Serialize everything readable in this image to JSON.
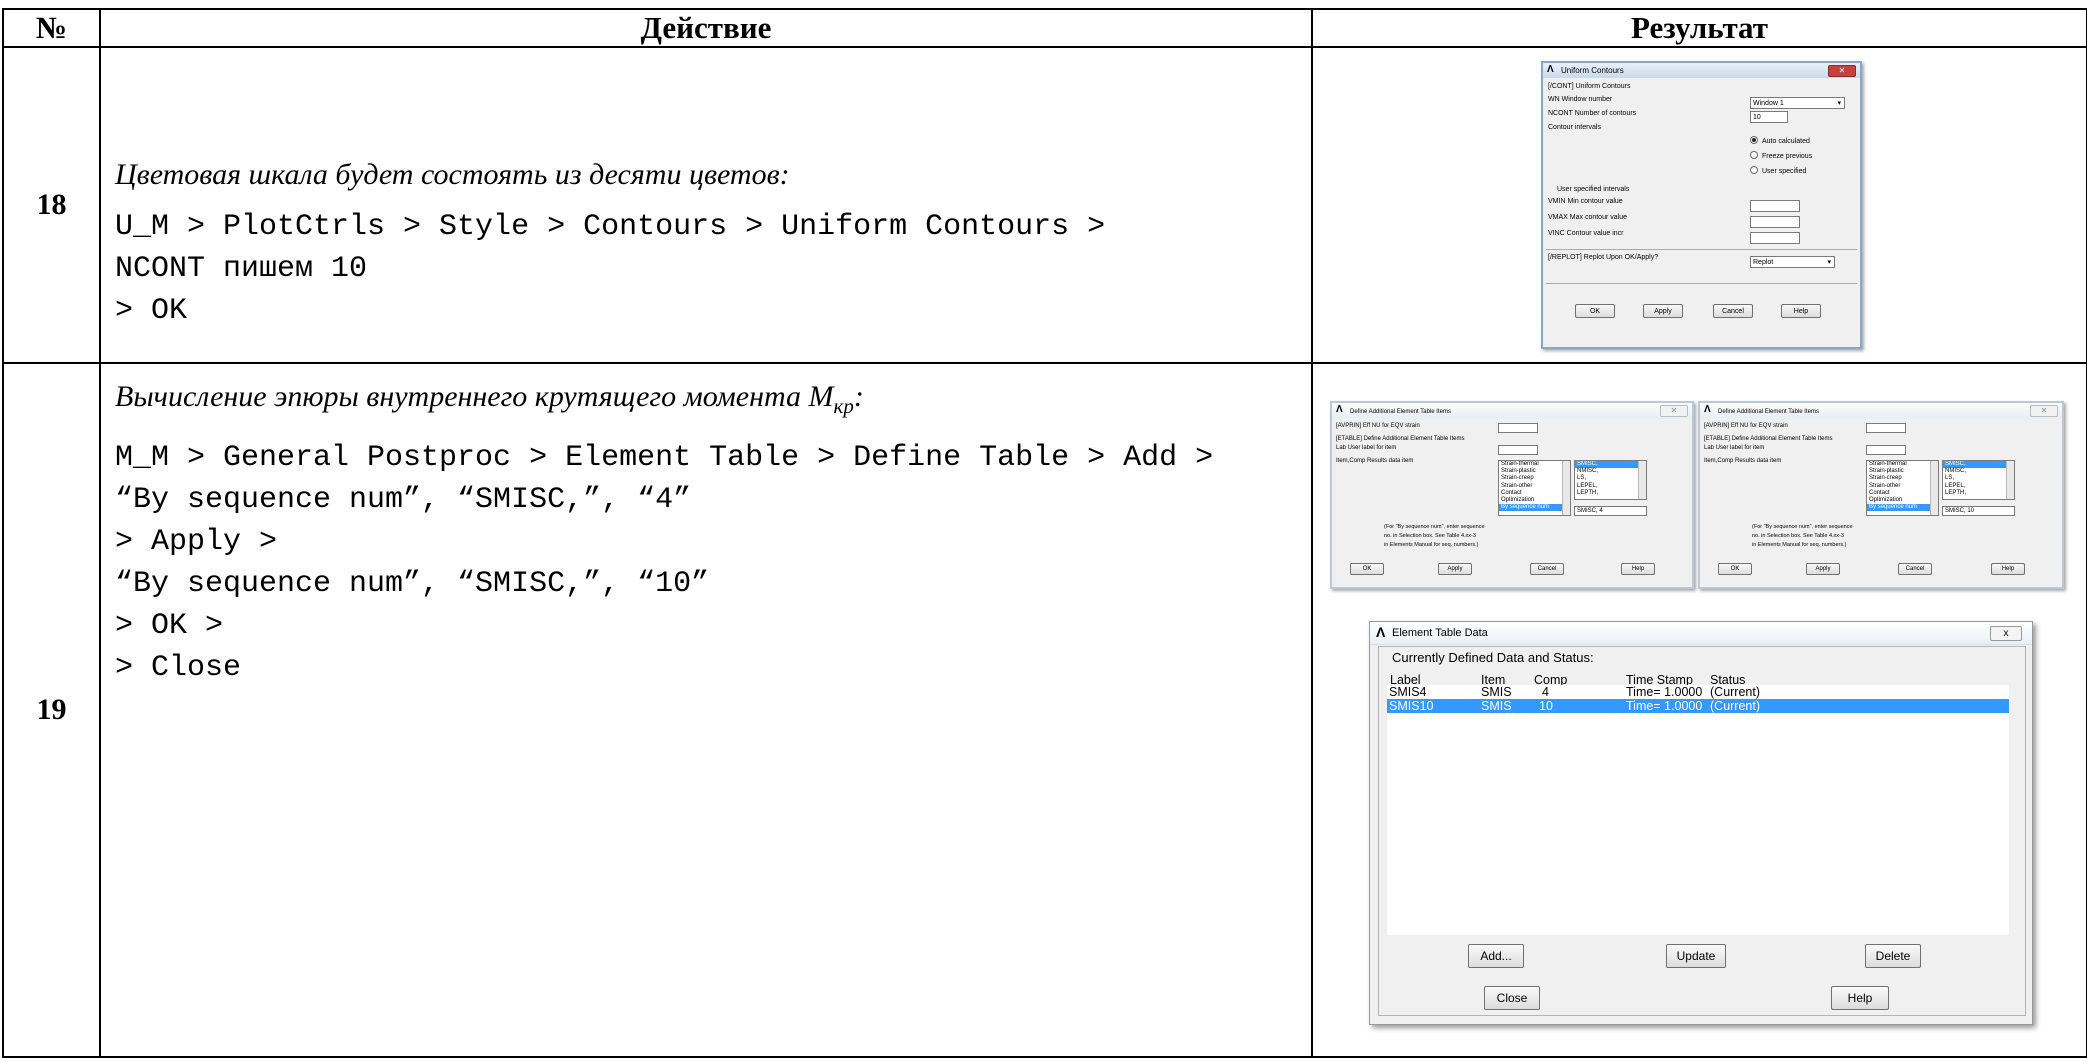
{
  "table": {
    "headers": [
      "№",
      "Действие",
      "Результат"
    ],
    "rows": [
      {
        "num": "18",
        "desc": "Цветовая шкала будет состоять из десяти цветов:",
        "lines": [
          "U_M > PlotCtrls > Style > Contours > Uniform Contours >",
          "NCONT пишем 10",
          "> OK"
        ]
      },
      {
        "num": "19",
        "desc_main": "Вычисление эпюры внутреннего крутящего момента M",
        "desc_sub": "кр",
        "desc_end": ":",
        "lines": [
          "M_M > General Postproc > Element Table > Define Table > Add >",
          "“By sequence num”, “SMISC,”, “4”",
          "> Apply >",
          "“By sequence num”, “SMISC,”, “10”",
          "> OK >",
          "> Close"
        ]
      }
    ]
  },
  "uniform_contours": {
    "title": "Uniform Contours",
    "cont_label": "[/CONT] Uniform Contours",
    "wn_label": "WN   Window number",
    "wn_value": "Window 1",
    "ncont_label": "NCONT  Number of contours",
    "ncont_value": "10",
    "intervals_label": "Contour intervals",
    "options": [
      "Auto calculated",
      "Freeze previous",
      "User specified"
    ],
    "user_label": "User specified intervals",
    "vmin_label": "VMIN   Min contour value",
    "vmax_label": "VMAX   Max contour value",
    "vinc_label": "VINC   Contour value incr",
    "replot_label": "[/REPLOT]  Replot Upon OK/Apply?",
    "replot_value": "Replot",
    "buttons": [
      "OK",
      "Apply",
      "Cancel",
      "Help"
    ]
  },
  "define_items": [
    {
      "title": "Define Additional Element Table Items",
      "avprin": "[AVPRIN]  Eff NU for EQV strain",
      "etable": "[ETABLE]  Define Additional Element Table Items",
      "lab": "Lab    User label for item",
      "itemcomp": "Item,Comp  Results data item",
      "list_left": [
        "Strain-thermal",
        "Strain-plastic",
        "Strain-creep",
        "Strain-other",
        "Contact",
        "Optimization",
        "By sequence num"
      ],
      "list_right": [
        "SMISC,",
        "NMISC,",
        "LS,",
        "LEPEL,",
        "LEPTH,"
      ],
      "value": "SMISC, 4",
      "note1": "(For \"By sequence num\", enter sequence",
      "note2": "no. in Selection box.  See Table 4.xx-3",
      "note3": "in Elements Manual for seq. numbers.)",
      "buttons": [
        "OK",
        "Apply",
        "Cancel",
        "Help"
      ]
    },
    {
      "title": "Define Additional Element Table Items",
      "avprin": "[AVPRIN]  Eff NU for EQV strain",
      "etable": "[ETABLE]  Define Additional Element Table Items",
      "lab": "Lab    User label for item",
      "itemcomp": "Item,Comp  Results data item",
      "list_left": [
        "Strain-thermal",
        "Strain-plastic",
        "Strain-creep",
        "Strain-other",
        "Contact",
        "Optimization",
        "By sequence num"
      ],
      "list_right": [
        "SMISC,",
        "NMISC,",
        "LS,",
        "LEPEL,",
        "LEPTH,"
      ],
      "value": "SMISC, 10",
      "note1": "(For \"By sequence num\", enter sequence",
      "note2": "no. in Selection box.  See Table 4.xx-3",
      "note3": "in Elements Manual for seq. numbers.)",
      "buttons": [
        "OK",
        "Apply",
        "Cancel",
        "Help"
      ]
    }
  ],
  "element_table": {
    "title": "Element Table Data",
    "heading": "Currently Defined Data and Status:",
    "columns": [
      "Label",
      "Item",
      "Comp",
      "Time Stamp",
      "Status"
    ],
    "rows": [
      [
        "SMIS4",
        "SMIS",
        "4",
        "Time=  1.0000",
        "(Current)"
      ],
      [
        "SMIS10",
        "SMIS",
        "10",
        "Time=  1.0000",
        "(Current)"
      ]
    ],
    "buttons": [
      "Add...",
      "Update",
      "Delete",
      "Close",
      "Help"
    ],
    "close_icon": "x"
  },
  "colors": {
    "selection": "#3399ff",
    "dialog_bg": "#f0f0f0"
  }
}
